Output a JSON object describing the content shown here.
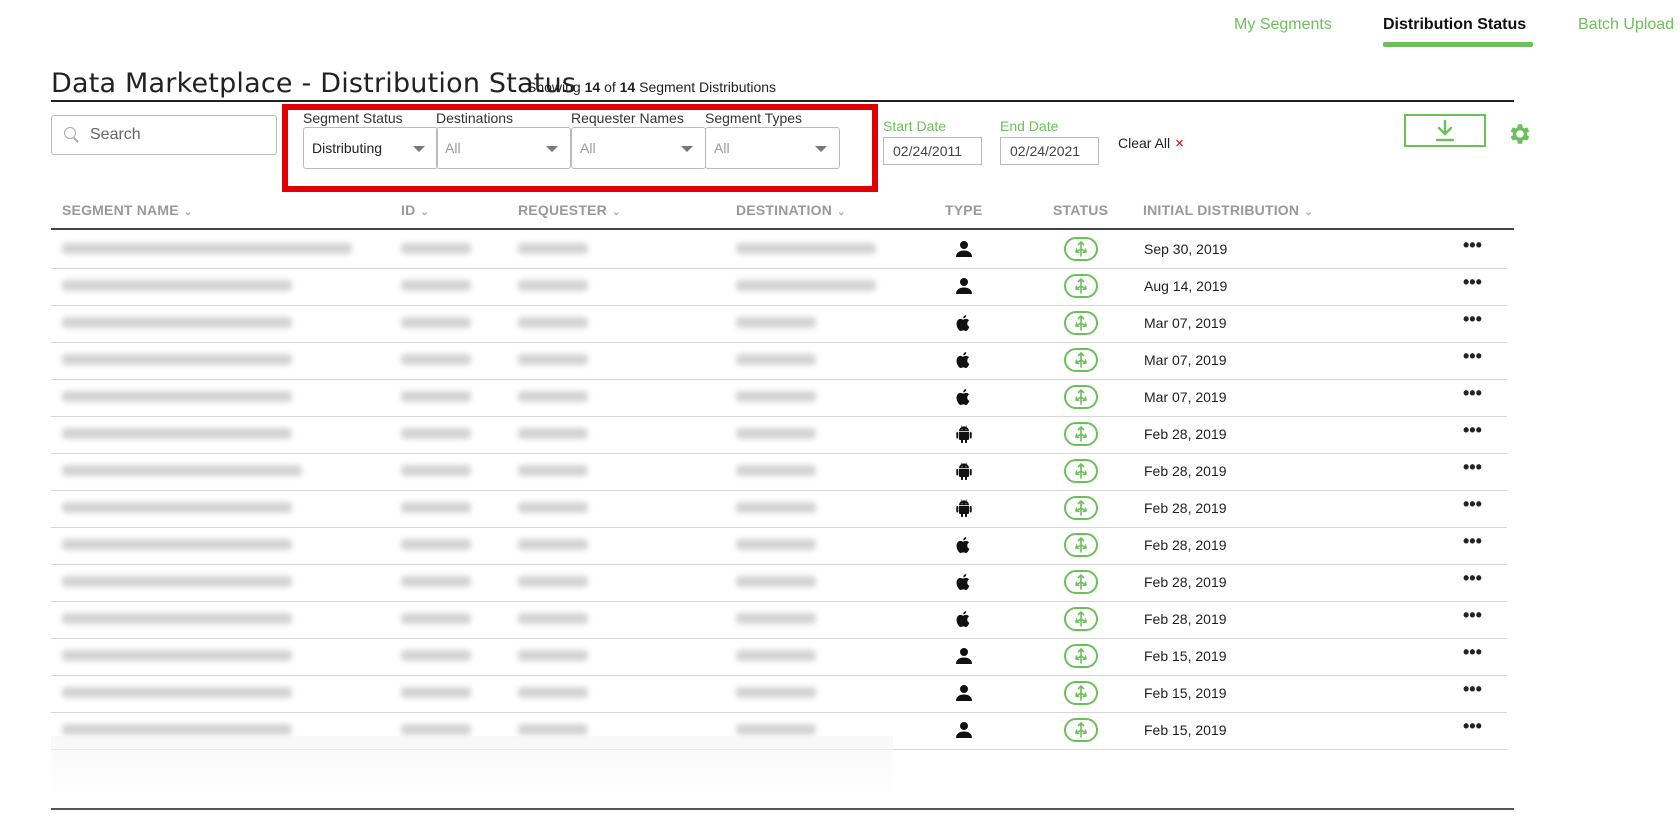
{
  "nav": {
    "tabs": [
      {
        "label": "My Segments",
        "active": false
      },
      {
        "label": "Distribution Status",
        "active": true
      },
      {
        "label": "Batch Upload",
        "active": false
      }
    ]
  },
  "header": {
    "title": "Data Marketplace - Distribution Status",
    "showing_prefix": "Showing",
    "showing_count": "14",
    "showing_of": "of",
    "showing_total": "14",
    "showing_suffix": "Segment Distributions"
  },
  "search": {
    "placeholder": "Search"
  },
  "filters": {
    "segment_status": {
      "label": "Segment Status",
      "value": "Distributing"
    },
    "destinations": {
      "label": "Destinations",
      "value": "All"
    },
    "requester_names": {
      "label": "Requester Names",
      "value": "All"
    },
    "segment_types": {
      "label": "Segment Types",
      "value": "All"
    },
    "start_date": {
      "label": "Start Date",
      "value": "02/24/2011"
    },
    "end_date": {
      "label": "End Date",
      "value": "02/24/2021"
    },
    "clear_all": "Clear All",
    "clear_icon": "×"
  },
  "toolbar": {
    "download_icon": "download-icon",
    "settings_icon": "gear-icon"
  },
  "colors": {
    "accent": "#6cbf5a",
    "highlight_border": "#e00000",
    "header_text": "#999999"
  },
  "table": {
    "columns": {
      "segment_name": "SEGMENT NAME",
      "id": "ID",
      "requester": "REQUESTER",
      "destination": "DESTINATION",
      "type": "TYPE",
      "status": "STATUS",
      "initial_distribution": "INITIAL DISTRIBUTION"
    },
    "rows": [
      {
        "type": "person",
        "status": "distributing",
        "date": "Sep 30, 2019"
      },
      {
        "type": "person",
        "status": "distributing",
        "date": "Aug 14, 2019"
      },
      {
        "type": "apple",
        "status": "distributing",
        "date": "Mar 07, 2019"
      },
      {
        "type": "apple",
        "status": "distributing",
        "date": "Mar 07, 2019"
      },
      {
        "type": "apple",
        "status": "distributing",
        "date": "Mar 07, 2019"
      },
      {
        "type": "android",
        "status": "distributing",
        "date": "Feb 28, 2019"
      },
      {
        "type": "android",
        "status": "distributing",
        "date": "Feb 28, 2019"
      },
      {
        "type": "android",
        "status": "distributing",
        "date": "Feb 28, 2019"
      },
      {
        "type": "apple",
        "status": "distributing",
        "date": "Feb 28, 2019"
      },
      {
        "type": "apple",
        "status": "distributing",
        "date": "Feb 28, 2019"
      },
      {
        "type": "apple",
        "status": "distributing",
        "date": "Feb 28, 2019"
      },
      {
        "type": "person",
        "status": "distributing",
        "date": "Feb 15, 2019"
      },
      {
        "type": "person",
        "status": "distributing",
        "date": "Feb 15, 2019"
      },
      {
        "type": "person",
        "status": "distributing",
        "date": "Feb 15, 2019"
      }
    ],
    "more_label": "•••"
  }
}
